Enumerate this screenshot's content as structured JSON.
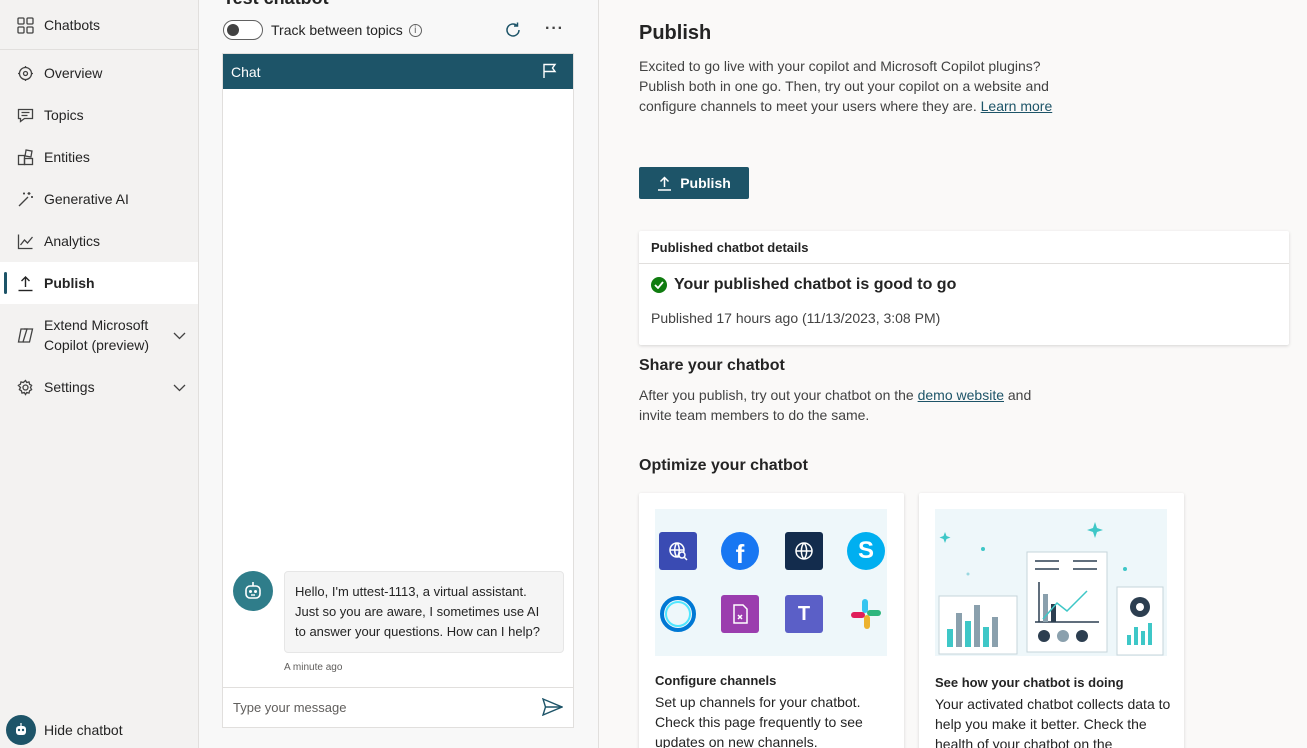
{
  "sidebar": {
    "top_item": "Chatbots",
    "items": [
      {
        "label": "Overview"
      },
      {
        "label": "Topics"
      },
      {
        "label": "Entities"
      },
      {
        "label": "Generative AI"
      },
      {
        "label": "Analytics"
      },
      {
        "label": "Publish"
      },
      {
        "label_line1": "Extend Microsoft",
        "label_line2": "Copilot (preview)"
      },
      {
        "label": "Settings"
      }
    ],
    "hide_chatbot": "Hide chatbot"
  },
  "test_panel": {
    "title": "Test chatbot",
    "track_label": "Track between topics",
    "chat_header": "Chat",
    "bot_message": "Hello, I'm uttest-1113, a virtual assistant. Just so you are aware, I sometimes use AI to answer your questions. How can I help?",
    "timestamp": "A minute ago",
    "input_placeholder": "Type your message"
  },
  "main": {
    "title": "Publish",
    "intro": "Excited to go live with your copilot and Microsoft Copilot plugins? Publish both in one go. Then, try out your copilot on a website and configure channels to meet your users where they are.",
    "learn_more": "Learn more",
    "publish_button": "Publish",
    "details": {
      "header": "Published chatbot details",
      "status": "Your published chatbot is good to go",
      "published_time": "Published 17 hours ago (11/13/2023, 3:08 PM)"
    },
    "share": {
      "title": "Share your chatbot",
      "text_before": "After you publish, try out your chatbot on the",
      "link": "demo website",
      "text_after": "and invite team members to do the same."
    },
    "optimize": {
      "title": "Optimize your chatbot",
      "cards": [
        {
          "title": "Configure channels",
          "text": "Set up channels for your chatbot. Check this page frequently to see updates on new channels."
        },
        {
          "title": "See how your chatbot is doing",
          "text": "Your activated chatbot collects data to help you make it better. Check the health of your chatbot on the"
        }
      ]
    }
  },
  "colors": {
    "accent": "#1d5468",
    "success": "#107c10"
  }
}
